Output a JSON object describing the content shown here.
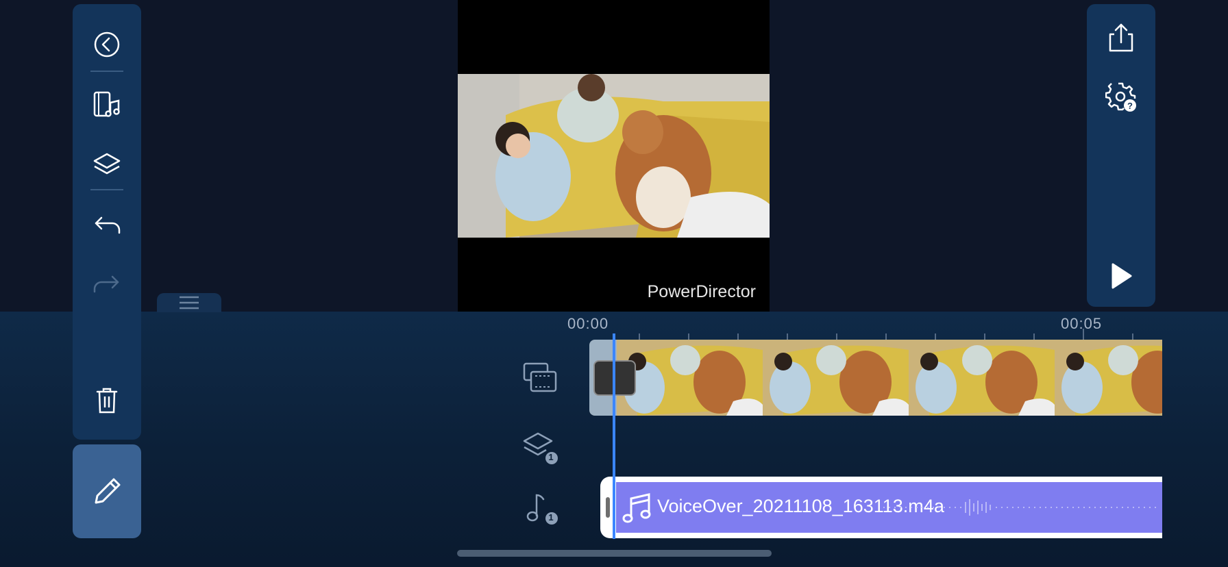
{
  "left_toolbar": {
    "buttons": [
      "back",
      "media-music",
      "layers",
      "undo",
      "redo",
      "delete"
    ],
    "redo_enabled": false
  },
  "right_toolbar": {
    "buttons": [
      "export",
      "settings-help",
      "play"
    ]
  },
  "preview": {
    "watermark": "PowerDirector"
  },
  "timeline": {
    "ruler": {
      "start": "00:00",
      "mark_5s": "00:05"
    },
    "tracks": {
      "video": {
        "clip_count": 4
      },
      "overlay": {
        "badge": "1"
      },
      "audio": {
        "badge": "1",
        "clip_name": "VoiceOver_20211108_163113.m4a"
      }
    }
  },
  "colors": {
    "toolbar_bg": "#13345a",
    "edit_button_bg": "#3a6293",
    "playhead": "#3b86ff",
    "audio_clip": "#7f7df0"
  }
}
